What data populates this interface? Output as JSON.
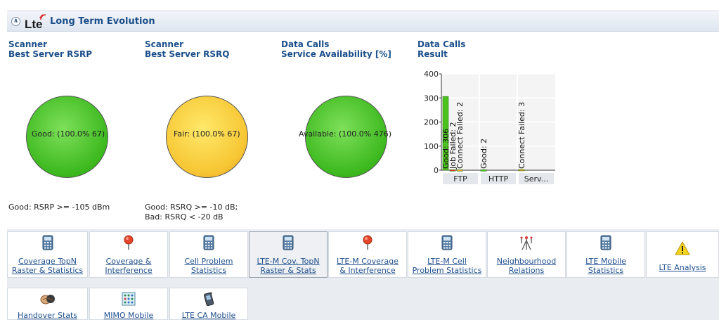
{
  "header": {
    "title": "Long Term Evolution",
    "logo_text": "Lte",
    "collapse_glyph": "»"
  },
  "panels": [
    {
      "title_line1": "Scanner",
      "title_line2": "Best Server RSRP",
      "pie_label": "Good: (100.0% 67)",
      "legend_line1": "Good: RSRP >= -105 dBm",
      "legend_line2": ""
    },
    {
      "title_line1": "Scanner",
      "title_line2": "Best Server RSRQ",
      "pie_label": "Fair: (100.0% 67)",
      "legend_line1": "Good: RSRQ >= -10 dB;",
      "legend_line2": "Bad: RSRQ < -20 dB"
    },
    {
      "title_line1": "Data Calls",
      "title_line2": "Service Availability [%]",
      "pie_label": "Available: (100.0% 476)",
      "legend_line1": "",
      "legend_line2": ""
    },
    {
      "title_line1": "Data Calls",
      "title_line2": "Result"
    }
  ],
  "chart_data": {
    "type": "bar",
    "categories": [
      "FTP",
      "HTTP",
      "Serv..."
    ],
    "ylim": [
      0,
      400
    ],
    "yticks": [
      0,
      100,
      200,
      300,
      400
    ],
    "bars": [
      {
        "category": "FTP",
        "label": "Good: 306",
        "value": 306,
        "color": "#4cc21f"
      },
      {
        "category": "FTP",
        "label": "Job Failed: 2",
        "value": 2,
        "color": "#e03a2a"
      },
      {
        "category": "FTP",
        "label": "Connect Failed: 2",
        "value": 2,
        "color": "#f5a623"
      },
      {
        "category": "HTTP",
        "label": "Good: 2",
        "value": 2,
        "color": "#4cc21f"
      },
      {
        "category": "Serv...",
        "label": "Connect Failed: 3",
        "value": 3,
        "color": "#f5a623"
      }
    ]
  },
  "tools": [
    {
      "label": "Coverage TopN\nRaster & Statistics",
      "icon": "calculator-icon",
      "selected": false
    },
    {
      "label": "Coverage &\nInterference",
      "icon": "pin-icon",
      "selected": false
    },
    {
      "label": "Cell Problem\nStatistics",
      "icon": "calculator-icon",
      "selected": false
    },
    {
      "label": "LTE-M Cov. TopN\nRaster & Stats",
      "icon": "calculator-icon",
      "selected": true
    },
    {
      "label": "LTE-M Coverage\n& Interference",
      "icon": "pin-icon",
      "selected": false
    },
    {
      "label": "LTE-M Cell\nProblem Statistics",
      "icon": "calculator-icon",
      "selected": false
    },
    {
      "label": "Neighbourhood\nRelations",
      "icon": "antenna-icon",
      "selected": false
    },
    {
      "label": "LTE Mobile\nStatistics",
      "icon": "calculator-icon",
      "selected": false
    },
    {
      "label": "LTE Analysis",
      "icon": "warning-icon",
      "selected": false
    },
    {
      "label": "Handover Stats",
      "icon": "handshake-icon",
      "selected": false
    },
    {
      "label": "MIMO Mobile",
      "icon": "grid-icon",
      "selected": false
    },
    {
      "label": "LTE CA Mobile",
      "icon": "phone-icon",
      "selected": false
    }
  ]
}
